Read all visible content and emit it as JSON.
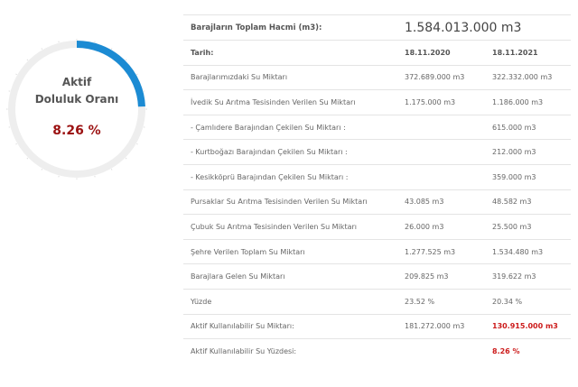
{
  "gauge": {
    "label_line1": "Aktif",
    "label_line2": "Doluluk Oranı",
    "value_text": "8.26 %",
    "percent": 8.26,
    "track_color": "#eeeeee",
    "fill_color": "#1c8bd3",
    "value_color": "#9b1111"
  },
  "table": {
    "header": {
      "label": "Barajların Toplam Hacmi (m3):",
      "value": "1.584.013.000 m3"
    },
    "date_row": {
      "label": "Tarih:",
      "col1": "18.11.2020",
      "col2": "18.11.2021"
    },
    "rows": [
      {
        "label": "Barajlarımızdaki Su Miktarı",
        "col1": "372.689.000 m3",
        "col2": "322.332.000 m3"
      },
      {
        "label": "İvedik Su Arıtma Tesisinden Verilen Su Miktarı",
        "col1": "1.175.000 m3",
        "col2": "1.186.000 m3"
      },
      {
        "label": "- Çamlıdere Barajından Çekilen Su Miktarı :",
        "col1": "",
        "col2": "615.000 m3"
      },
      {
        "label": "- Kurtboğazı Barajından Çekilen Su Miktarı :",
        "col1": "",
        "col2": "212.000 m3"
      },
      {
        "label": "- Kesikköprü Barajından Çekilen Su Miktarı :",
        "col1": "",
        "col2": "359.000 m3"
      },
      {
        "label": "Pursaklar Su Arıtma Tesisinden Verilen Su Miktarı",
        "col1": "43.085 m3",
        "col2": "48.582 m3"
      },
      {
        "label": "Çubuk Su Arıtma Tesisinden Verilen Su Miktarı",
        "col1": "26.000 m3",
        "col2": "25.500 m3"
      },
      {
        "label": "Şehre Verilen Toplam Su Miktarı",
        "col1": "1.277.525 m3",
        "col2": "1.534.480 m3"
      },
      {
        "label": "Barajlara Gelen Su Miktarı",
        "col1": "209.825 m3",
        "col2": "319.622 m3"
      },
      {
        "label": "Yüzde",
        "col1": "23.52 %",
        "col2": "20.34 %"
      },
      {
        "label": "Aktif Kullanılabilir Su Miktarı:",
        "col1": "181.272.000 m3",
        "col2": "130.915.000 m3"
      },
      {
        "label": "Aktif Kullanılabilir Su Yüzdesi:",
        "col1": "",
        "col2": "8.26 %"
      }
    ],
    "highlight_color": "#cc1b1b"
  }
}
